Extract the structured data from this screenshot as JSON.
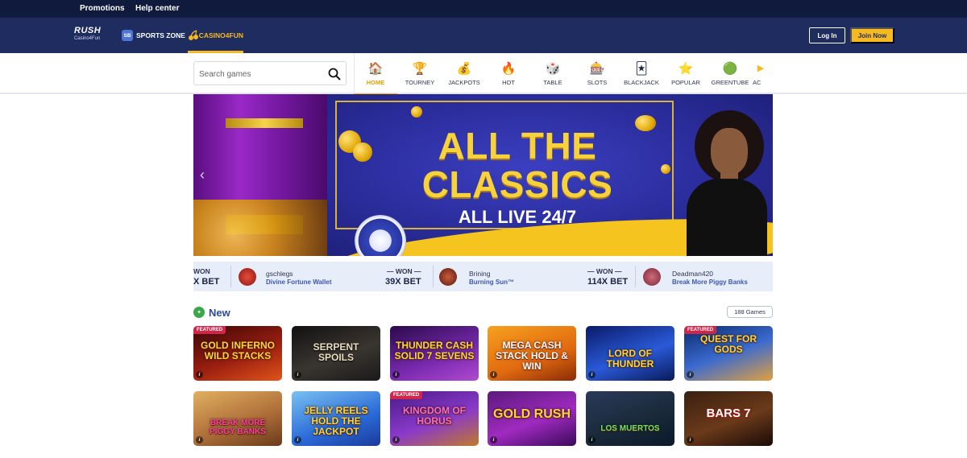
{
  "topbar": {
    "links": [
      "Promotions",
      "Help center"
    ]
  },
  "header": {
    "logo": {
      "line1": "RUSH",
      "line2": "Casino4Fun"
    },
    "brands": [
      {
        "label": "SPORTS ZONE",
        "icon": "sportsbook-badge-icon",
        "badge_text": "SB"
      },
      {
        "label": "CASINO4FUN",
        "icon": "cherries-icon",
        "active": true
      }
    ],
    "login_label": "Log In",
    "join_label": "Join Now",
    "accent_color": "#f5b921",
    "bg_color": "#1e2c5f"
  },
  "search": {
    "placeholder": "Search games"
  },
  "categories": [
    {
      "label": "HOME",
      "icon": "house-icon",
      "glyph": "🏠",
      "active": true
    },
    {
      "label": "TOURNEY",
      "icon": "trophy-icon",
      "glyph": "🏆"
    },
    {
      "label": "JACKPOTS",
      "icon": "jackpot-icon",
      "glyph": "💰"
    },
    {
      "label": "HOT",
      "icon": "flame-icon",
      "glyph": "🔥"
    },
    {
      "label": "TABLE",
      "icon": "chips-icon",
      "glyph": "🎲"
    },
    {
      "label": "SLOTS",
      "icon": "slot-machine-icon",
      "glyph": "🎰"
    },
    {
      "label": "BLACKJACK",
      "icon": "cards-icon",
      "glyph": "🃏"
    },
    {
      "label": "POPULAR",
      "icon": "star-badge-icon",
      "glyph": "⭐"
    },
    {
      "label": "GREENTUBE",
      "icon": "greentube-icon",
      "glyph": "🟢"
    },
    {
      "label": "AC",
      "icon": "play-icon",
      "glyph": "▶"
    }
  ],
  "hero": {
    "headline": "ALL THE CLASSICS",
    "subline": "ALL LIVE 24/7"
  },
  "winners": [
    {
      "label": "WON",
      "multiplier": "X BET"
    },
    {
      "username": "gschlegs",
      "game": "Divine Fortune Wallet",
      "label": "— WON —",
      "multiplier": "39X BET"
    },
    {
      "username": "Brining",
      "game": "Burning Sun™",
      "label": "— WON —",
      "multiplier": "114X BET"
    },
    {
      "username": "Deadman420",
      "game": "Break More Piggy Banks"
    }
  ],
  "new_section": {
    "title": "New",
    "count": "188 Games",
    "featured_label": "FEATURED",
    "tiles_row1": [
      {
        "title": "GOLD INFERNO WILD STACKS",
        "featured": true,
        "bg": "#7a1010"
      },
      {
        "title": "SERPENT SPOILS",
        "featured": false,
        "bg": "#2b2b2b"
      },
      {
        "title": "THUNDER CASH SOLID 7 SEVENS",
        "featured": false,
        "bg": "#5a1a8a"
      },
      {
        "title": "MEGA CASH STACK HOLD & WIN",
        "featured": false,
        "bg": "#e0701a"
      },
      {
        "title": "LORD OF THUNDER",
        "featured": false,
        "bg": "#1f3fa8"
      },
      {
        "title": "QUEST FOR GODS",
        "featured": true,
        "bg": "#244a9a"
      }
    ],
    "tiles_row2": [
      {
        "title": "BREAK MORE PIGGY BANKS",
        "featured": false,
        "bg": "#b07a3a"
      },
      {
        "title": "JELLY REELS HOLD THE JACKPOT",
        "featured": false,
        "bg": "#3a8ad8"
      },
      {
        "title": "KINGDOM OF HORUS",
        "featured": true,
        "bg": "#6a2aa0"
      },
      {
        "title": "GOLD RUSH",
        "featured": false,
        "bg": "#8a2a9a"
      },
      {
        "title": "LOS MUERTOS",
        "featured": false,
        "bg": "#1e2a3a"
      },
      {
        "title": "BARS 7",
        "featured": false,
        "bg": "#2a1a12"
      }
    ]
  }
}
